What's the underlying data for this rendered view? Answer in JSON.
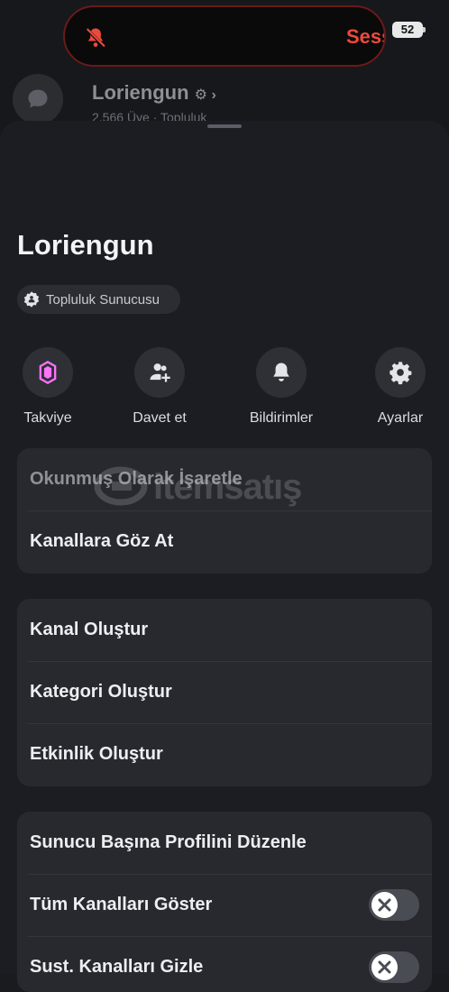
{
  "status_bar": {
    "notification_text": "Sess",
    "battery_level": "52"
  },
  "background_header": {
    "server_name": "Loriengun",
    "subtitle": "2.566 Üye · Topluluk"
  },
  "sheet": {
    "server_name": "Loriengun",
    "badge_label": "Topluluk Sunucusu",
    "actions": [
      {
        "label": "Takviye",
        "icon": "boost-icon"
      },
      {
        "label": "Davet et",
        "icon": "invite-icon"
      },
      {
        "label": "Bildirimler",
        "icon": "bell-icon"
      },
      {
        "label": "Ayarlar",
        "icon": "gear-icon"
      }
    ],
    "group1": [
      {
        "label": "Okunmuş Olarak İşaretle"
      },
      {
        "label": "Kanallara Göz At"
      }
    ],
    "group2": [
      {
        "label": "Kanal Oluştur"
      },
      {
        "label": "Kategori Oluştur"
      },
      {
        "label": "Etkinlik Oluştur"
      }
    ],
    "group3": [
      {
        "label": "Sunucu Başına Profilini Düzenle"
      },
      {
        "label": "Tüm Kanalları Göster",
        "toggle_on": false
      },
      {
        "label": "Sust. Kanalları Gizle",
        "toggle_on": false
      }
    ]
  },
  "watermark": {
    "text": "itemsatış"
  },
  "colors": {
    "accent_red": "#ed4a3b",
    "boost_pink": "#ff73fa",
    "sheet_bg": "#1c1d22",
    "group_bg": "#28292f"
  }
}
